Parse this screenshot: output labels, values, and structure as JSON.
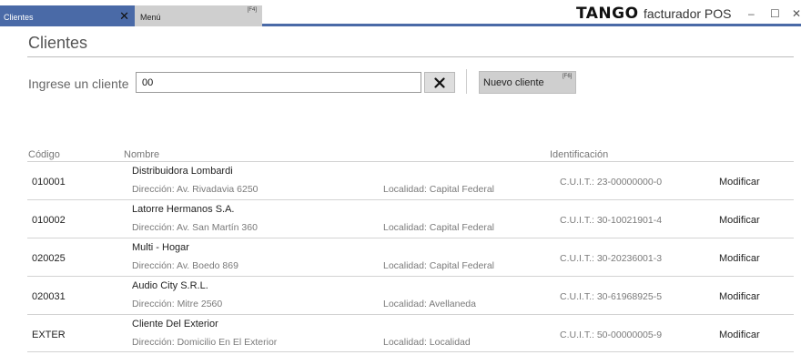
{
  "tabs": {
    "clientes": {
      "label": "Clientes",
      "close_glyph": "✕"
    },
    "menu": {
      "label": "Menú",
      "key": "[F4]"
    }
  },
  "brand": {
    "logo": "TANGO",
    "app": "facturador POS"
  },
  "window_controls": {
    "minimize": "–",
    "maximize": "☐",
    "close": "✕"
  },
  "page": {
    "title": "Clientes"
  },
  "search": {
    "label": "Ingrese un cliente",
    "value": "00",
    "placeholder": ""
  },
  "toolbar": {
    "new_client_label": "Nuevo cliente",
    "new_client_key": "[F6]"
  },
  "table": {
    "headers": {
      "codigo": "Código",
      "nombre": "Nombre",
      "identificacion": "Identificación"
    },
    "action_label": "Modificar",
    "rows": [
      {
        "codigo": "010001",
        "nombre": "Distribuidora Lombardi",
        "direccion": "Dirección: Av. Rivadavia 6250",
        "localidad": "Localidad: Capital Federal",
        "identificacion": "C.U.I.T.: 23-00000000-0"
      },
      {
        "codigo": "010002",
        "nombre": "Latorre Hermanos S.A.",
        "direccion": "Dirección: Av. San Martín 360",
        "localidad": "Localidad: Capital Federal",
        "identificacion": "C.U.I.T.: 30-10021901-4"
      },
      {
        "codigo": "020025",
        "nombre": "Multi - Hogar",
        "direccion": "Dirección: Av. Boedo 869",
        "localidad": "Localidad: Capital Federal",
        "identificacion": "C.U.I.T.: 30-20236001-3"
      },
      {
        "codigo": "020031",
        "nombre": "Audio City S.R.L.",
        "direccion": "Dirección: Mitre 2560",
        "localidad": "Localidad: Avellaneda",
        "identificacion": "C.U.I.T.: 30-61968925-5"
      },
      {
        "codigo": "EXTER",
        "nombre": "Cliente Del Exterior",
        "direccion": "Dirección: Domicilio En El Exterior",
        "localidad": "Localidad: Localidad",
        "identificacion": "C.U.I.T.: 50-00000005-9"
      }
    ]
  },
  "colors": {
    "accent": "#4a6aa7",
    "button_gray": "#cfcfcf",
    "divider": "#d3d3d3"
  }
}
